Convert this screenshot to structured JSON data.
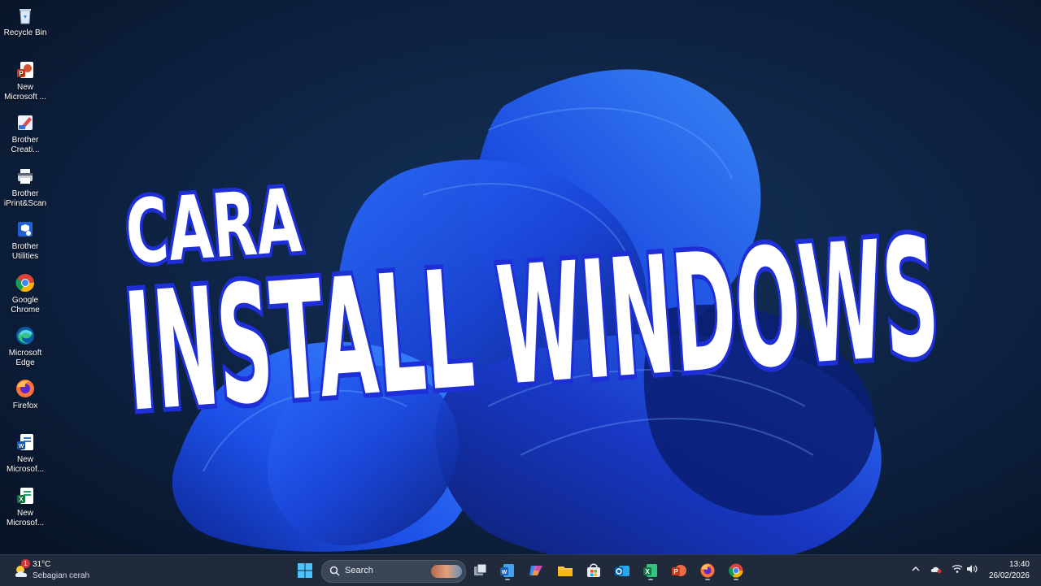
{
  "desktop": {
    "icons": [
      {
        "label": "Recycle Bin",
        "icon": "recycle-bin-icon"
      },
      {
        "label": "New\nMicrosoft ...",
        "icon": "powerpoint-file-icon"
      },
      {
        "label": "Brother\nCreati...",
        "icon": "brother-creative-icon"
      },
      {
        "label": "Brother\niPrint&Scan",
        "icon": "brother-iprint-icon"
      },
      {
        "label": "Brother\nUtilities",
        "icon": "brother-utilities-icon"
      },
      {
        "label": "Google\nChrome",
        "icon": "chrome-icon"
      },
      {
        "label": "Microsoft\nEdge",
        "icon": "edge-icon"
      },
      {
        "label": "Firefox",
        "icon": "firefox-icon"
      },
      {
        "label": "New\nMicrosof...",
        "icon": "word-file-icon"
      },
      {
        "label": "New\nMicrosof...",
        "icon": "excel-file-icon"
      }
    ]
  },
  "headline": {
    "line1": "CARA",
    "line2": "INSTALL WINDOWS"
  },
  "taskbar": {
    "weather": {
      "badge": "1",
      "temp": "31°C",
      "desc": "Sebagian cerah"
    },
    "search": {
      "placeholder": "Search"
    },
    "apps": [
      "start-icon",
      "search",
      "task-view-icon",
      "word-icon",
      "copilot-icon",
      "file-explorer-icon",
      "microsoft-store-icon",
      "outlook-icon",
      "excel-icon",
      "powerpoint-icon",
      "firefox-icon",
      "chrome-icon"
    ],
    "clock": {
      "time": "13:40",
      "date": "26/02/2026"
    }
  },
  "colors": {
    "wallpaper_bg": "#0b1a33",
    "bloom_blue": "#1f4fe0",
    "headline_fill": "#ffffff",
    "headline_stroke": "#1e2fd8",
    "taskbar_bg": "#202a3a"
  }
}
